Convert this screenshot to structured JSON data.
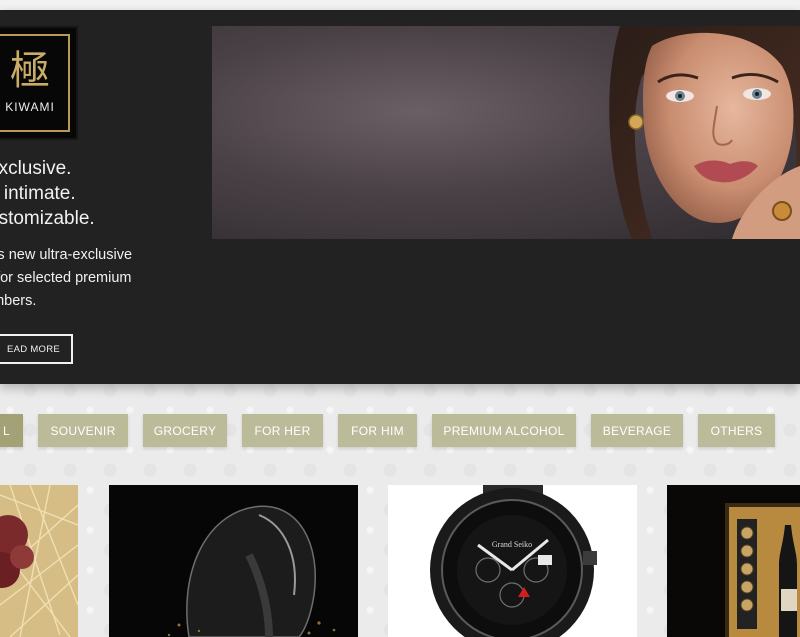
{
  "hero": {
    "logo": {
      "kanji": "極",
      "brand": "KIWAMI"
    },
    "tagline": [
      "exclusive.",
      "e intimate.",
      "ustomizable."
    ],
    "description": [
      "H’s new ultra-exclusive",
      "e for selected premium",
      "embers."
    ],
    "read_more_label": "EAD MORE"
  },
  "categories": {
    "tabs": [
      {
        "label": "L",
        "active": true
      },
      {
        "label": "SOUVENIR",
        "active": false
      },
      {
        "label": "GROCERY",
        "active": false
      },
      {
        "label": "FOR HER",
        "active": false
      },
      {
        "label": "FOR HIM",
        "active": false
      },
      {
        "label": "PREMIUM ALCOHOL",
        "active": false
      },
      {
        "label": "BEVERAGE",
        "active": false
      },
      {
        "label": "OTHERS",
        "active": false
      }
    ]
  },
  "products": [
    {
      "image": "grapes-in-straw"
    },
    {
      "image": "black-sculptural-device"
    },
    {
      "image": "chronograph-watch"
    },
    {
      "image": "wine-gift-box"
    }
  ],
  "colors": {
    "hero_bg": "#222222",
    "tab_bg": "#bcbb99",
    "tab_active_bg": "#a2a276",
    "logo_gold": "#b69a52"
  },
  "watch": {
    "brand": "Grand Seiko"
  }
}
